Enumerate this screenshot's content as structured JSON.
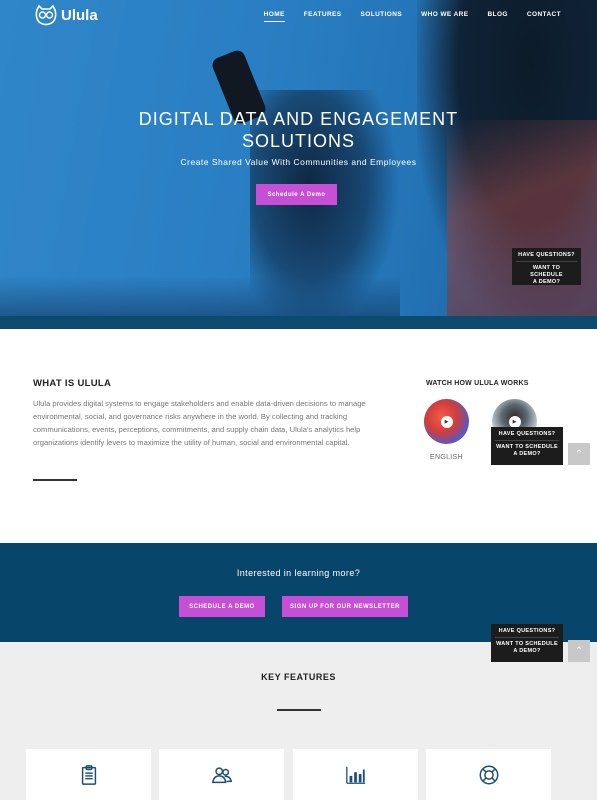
{
  "brand": {
    "name": "Ulula"
  },
  "nav": {
    "items": [
      {
        "label": "HOME",
        "active": true
      },
      {
        "label": "FEATURES"
      },
      {
        "label": "SOLUTIONS"
      },
      {
        "label": "WHO WE ARE"
      },
      {
        "label": "BLOG"
      },
      {
        "label": "CONTACT"
      }
    ]
  },
  "hero": {
    "title_line1": "DIGITAL DATA AND ENGAGEMENT",
    "title_line2": "SOLUTIONS",
    "subtitle": "Create Shared Value With Communities and Employees",
    "cta_label": "Schedule A Demo"
  },
  "question_box": {
    "line1": "HAVE QUESTIONS?",
    "line2a": "WANT TO SCHEDULE",
    "line2b": "A DEMO?"
  },
  "scroll_top": {
    "icon": "chevron-up-icon",
    "glyph": "⌃"
  },
  "what_is": {
    "title": "WHAT IS ULULA",
    "body": "Ulula provides digital systems to engage stakeholders and enable data-driven decisions to manage environmental, social, and governance risks anywhere in the world. By collecting and tracking communications, events, perceptions, commitments, and supply chain data, Ulula's analytics help organizations identify levers to maximize the utility of human, social and environmental capital."
  },
  "watch": {
    "title": "WATCH HOW ULULA WORKS",
    "videos": [
      {
        "label": "ENGLISH"
      },
      {
        "label": ""
      }
    ]
  },
  "cta": {
    "text": "Interested in learning more?",
    "btn1": "SCHEDULE A DEMO",
    "btn2": "SIGN UP FOR OUR NEWSLETTER"
  },
  "features": {
    "title": "KEY FEATURES",
    "cards": [
      {
        "icon": "clipboard-icon"
      },
      {
        "icon": "users-icon"
      },
      {
        "icon": "bar-chart-icon"
      },
      {
        "icon": "lifebuoy-icon"
      }
    ]
  },
  "colors": {
    "accent": "#c74fd5",
    "navy": "#08456b",
    "hero_blue": "#2a7fc4",
    "icon_blue": "#1b4f78"
  }
}
